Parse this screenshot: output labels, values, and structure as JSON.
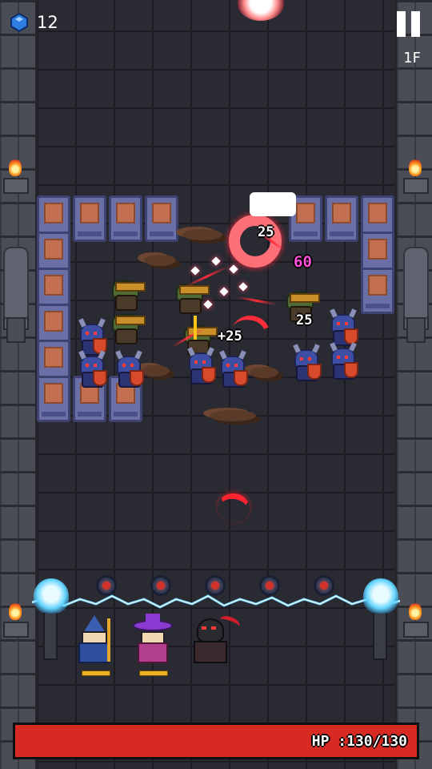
{
  "hud": {
    "gem_count": "12",
    "gem_icon": "blue-gem-icon",
    "floor": "1F",
    "pause_icon": "pause-icon",
    "hp_text": "HP :130/130",
    "hp_current": 130,
    "hp_max": 130,
    "hp_color": "#d72a22"
  },
  "combat_text": {
    "dmg_top": "25",
    "dmg_crit": "60",
    "dmg_center": "+25",
    "dmg_right": "25"
  },
  "party": [
    {
      "name": "wizard",
      "icon": "blue-wizard-icon"
    },
    {
      "name": "witch",
      "icon": "purple-witch-icon"
    },
    {
      "name": "reaper",
      "icon": "red-reaper-icon"
    }
  ]
}
